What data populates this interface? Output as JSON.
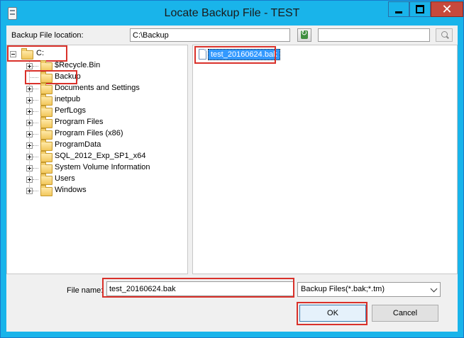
{
  "window": {
    "title": "Locate Backup File - TEST",
    "controls": [
      "minimize",
      "maximize",
      "close"
    ],
    "close_glyph": "✕"
  },
  "location": {
    "label": "Backup File location:",
    "value": "C:\\Backup",
    "search_value": ""
  },
  "tree": {
    "root": "C:",
    "items": [
      {
        "label": "$Recycle.Bin",
        "expandable": true
      },
      {
        "label": "Backup",
        "expandable": false,
        "highlighted": true
      },
      {
        "label": "Documents and Settings",
        "expandable": true
      },
      {
        "label": "inetpub",
        "expandable": true
      },
      {
        "label": "PerfLogs",
        "expandable": true
      },
      {
        "label": "Program Files",
        "expandable": true
      },
      {
        "label": "Program Files (x86)",
        "expandable": true
      },
      {
        "label": "ProgramData",
        "expandable": true
      },
      {
        "label": "SQL_2012_Exp_SP1_x64",
        "expandable": true
      },
      {
        "label": "System Volume Information",
        "expandable": true
      },
      {
        "label": "Users",
        "expandable": true
      },
      {
        "label": "Windows",
        "expandable": true
      }
    ]
  },
  "files": {
    "items": [
      {
        "name": "test_20160624.bak",
        "selected": true
      }
    ]
  },
  "filename": {
    "label": "File name:",
    "value": "test_20160624.bak"
  },
  "filter": {
    "selected": "Backup Files(*.bak;*.tm)"
  },
  "buttons": {
    "ok": "OK",
    "cancel": "Cancel"
  },
  "colors": {
    "title_bar": "#19b4ea",
    "close_button": "#c7493c",
    "selection": "#3399ff",
    "annotation": "#d9312a"
  }
}
